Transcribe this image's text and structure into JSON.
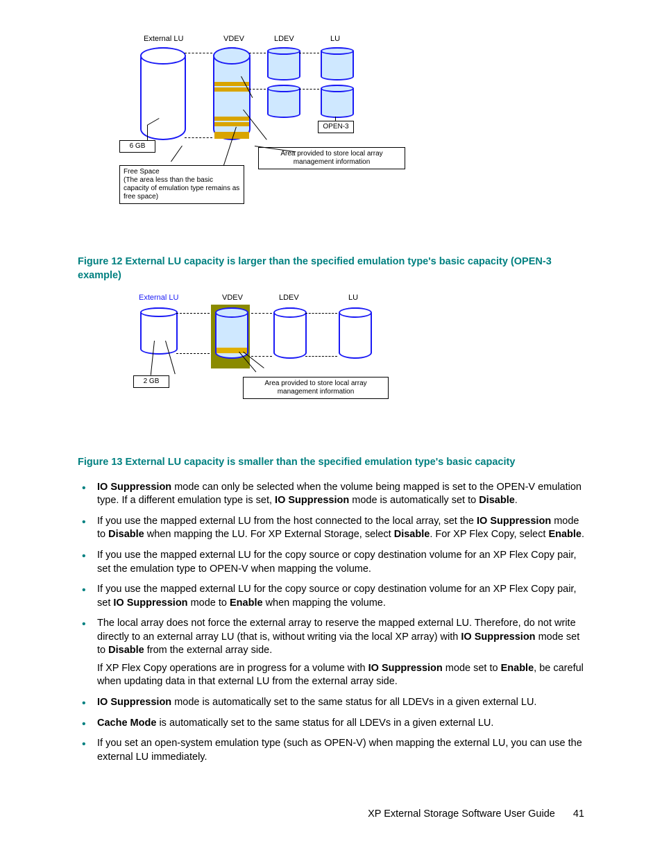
{
  "figure12": {
    "labels": {
      "externalLU": "External LU",
      "vdev": "VDEV",
      "ldev": "LDEV",
      "lu": "LU"
    },
    "sixGB": "6 GB",
    "open3": "OPEN-3",
    "mgmtBox": "Area provided to store local array management information",
    "freeSpaceBox": "Free Space\n(The area less than the basic capacity of emulation type remains as free space)",
    "caption": "Figure 12 External LU capacity is larger than the specified emulation type's basic capacity (OPEN-3 example)"
  },
  "figure13": {
    "labels": {
      "externalLU": "External LU",
      "vdev": "VDEV",
      "ldev": "LDEV",
      "lu": "LU"
    },
    "twoGB": "2 GB",
    "mgmtBox": "Area provided to store local array management information",
    "caption": "Figure 13 External LU capacity is smaller than the specified emulation type's basic capacity"
  },
  "bullets": {
    "b1a": "IO Suppression",
    "b1b": " mode can only be selected when the volume being mapped is set to the OPEN-V emulation type. If a different emulation type is set, ",
    "b1c": "IO Suppression",
    "b1d": " mode is automatically set to ",
    "b1e": "Disable",
    "b1f": ".",
    "b2a": "If you use the mapped external LU from the host connected to the local array, set the ",
    "b2b": "IO Suppression",
    "b2c": " mode to ",
    "b2d": "Disable",
    "b2e": " when mapping the LU. For XP External Storage, select ",
    "b2f": "Disable",
    "b2g": ". For XP Flex Copy, select ",
    "b2h": "Enable",
    "b2i": ".",
    "b3": "If you use the mapped external LU for the copy source or copy destination volume for an XP Flex Copy pair, set the emulation type to OPEN-V when mapping the volume.",
    "b4a": "If you use the mapped external LU for the copy source or copy destination volume for an XP Flex Copy pair, set ",
    "b4b": "IO Suppression",
    "b4c": " mode to ",
    "b4d": "Enable",
    "b4e": " when mapping the volume.",
    "b5a": "The local array does not force the external array to reserve the mapped external LU. Therefore, do not write directly to an external array LU (that is, without writing via the local XP array) with ",
    "b5b": "IO Suppression",
    "b5c": " mode set to ",
    "b5d": "Disable",
    "b5e": " from the external array side.",
    "b5p2a": "If XP Flex Copy operations are in progress for a volume with ",
    "b5p2b": "IO Suppression",
    "b5p2c": " mode set to ",
    "b5p2d": "Enable",
    "b5p2e": ", be careful when updating data in that external LU from the external array side.",
    "b6a": "IO Suppression",
    "b6b": " mode is automatically set to the same status for all LDEVs in a given external LU.",
    "b7a": "Cache Mode",
    "b7b": " is automatically set to the same status for all LDEVs in a given external LU.",
    "b8": "If you set an open-system emulation type (such as OPEN-V) when mapping the external LU, you can use the external LU immediately."
  },
  "footer": {
    "text": "XP External Storage Software User Guide",
    "page": "41"
  }
}
